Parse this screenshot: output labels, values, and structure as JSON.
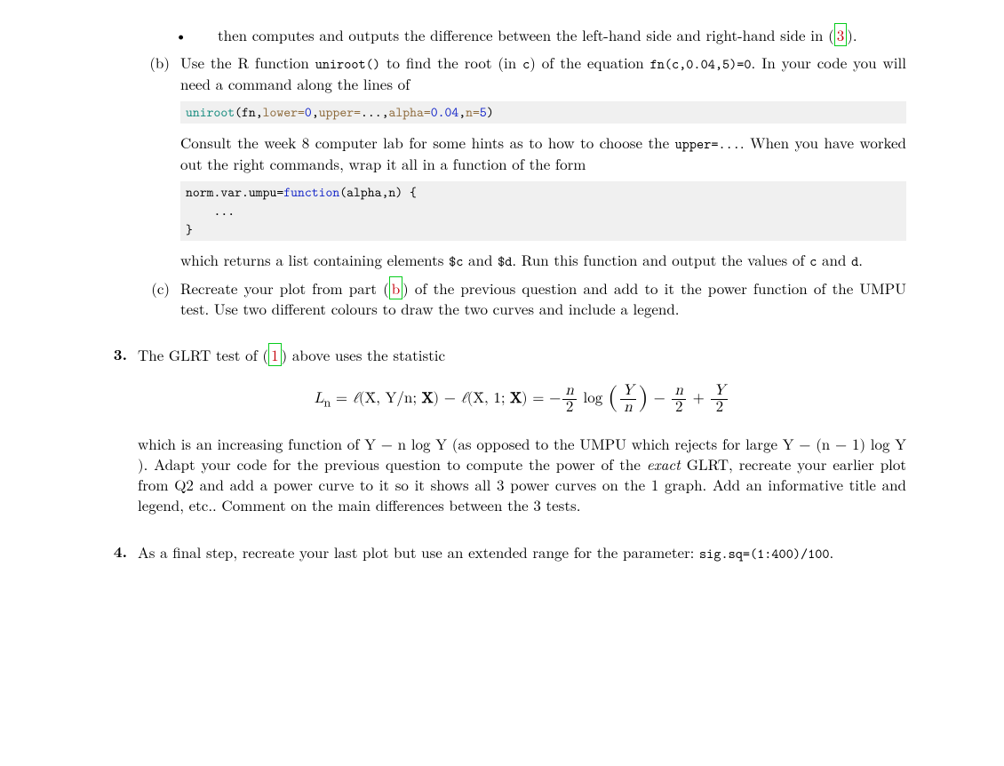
{
  "bullet": {
    "text1": "then computes and outputs the difference between the left-hand side and right-hand side in (",
    "ref": "3",
    "text2": ")."
  },
  "partb": {
    "label": "(b)",
    "p1a": "Use the R function ",
    "code1": "uniroot()",
    "p1b": " to find the root (in ",
    "code2": "c",
    "p1c": ") of the equation ",
    "code3": "fn(c,0.04,5)=0",
    "p1d": ". In your code you will need a command along the lines of",
    "codeline": {
      "seg1": "uniroot",
      "seg2": "(fn,",
      "seg3": "lower=",
      "seg4": "0",
      "seg5": ",",
      "seg6": "upper=",
      "seg7": "...,",
      "seg8": "alpha=",
      "seg9": "0.04",
      "seg10": ",",
      "seg11": "n=",
      "seg12": "5",
      "seg13": ")"
    },
    "p2a": "Consult the week 8 computer lab for some hints as to how to choose the ",
    "code4": "upper=...",
    "p2b": ". When you have worked out the right commands, wrap it all in a function of the form",
    "codeline2": {
      "l1a": "norm.var.umpu=",
      "l1b": "function",
      "l1c": "(alpha,n) {",
      "l2": "    ...",
      "l3": "}"
    },
    "p3a": "which returns a list containing elements ",
    "code5": "$c",
    "p3b": " and ",
    "code6": "$d",
    "p3c": ". Run this function and output the values of ",
    "code7": "c",
    "p3d": " and ",
    "code8": "d",
    "p3e": "."
  },
  "partc": {
    "label": "(c)",
    "p1a": "Recreate your plot from part (",
    "ref": "b",
    "p1b": ") of the previous question and add to it the power function of the UMPU test. Use two different colours to draw the two curves and include a legend."
  },
  "q3": {
    "label": "3.",
    "p1a": "The GLRT test of (",
    "ref": "1",
    "p1b": ") above uses the statistic",
    "math": {
      "Ln": "L",
      "sub_n": "n",
      "eq": " = ",
      "ell1": "ℓ",
      "args1a": "(X̄, Y/n; ",
      "X": "X",
      "args1b": ") − ",
      "ell2": "ℓ",
      "args2a": "(X̄, 1; ",
      "args2b": ") = −",
      "n": "n",
      "two": "2",
      "log": " log ",
      "Y": "Y",
      "minus": " − ",
      "plus": " + "
    },
    "p2": "which is an increasing function of Y − n log Y (as opposed to the UMPU which rejects for large Y − (n − 1) log Y ). Adapt your code for the previous question to compute the power of the ",
    "exact": "exact",
    "p2b": " GLRT, recreate your earlier plot from Q2 and add a power curve to it so it shows all 3 power curves on the 1 graph. Add an informative title and legend, etc.. Comment on the main differences between the 3 tests."
  },
  "q4": {
    "label": "4.",
    "p1a": "As a final step, recreate your last plot but use an extended range for the parameter: ",
    "code1": "sig.sq=(1:400)/100",
    "p1b": "."
  }
}
